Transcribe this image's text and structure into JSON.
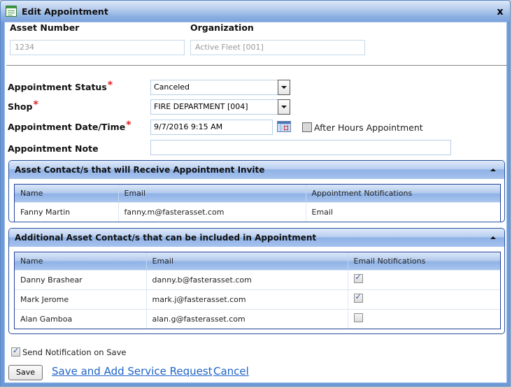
{
  "window": {
    "title": "Edit Appointment",
    "close_glyph": "x"
  },
  "header_fields": {
    "asset_number": {
      "label": "Asset Number",
      "value": "1234"
    },
    "organization": {
      "label": "Organization",
      "value": "Active Fleet [001]"
    }
  },
  "form": {
    "appointment_status": {
      "label": "Appointment Status",
      "required_mark": "*",
      "value": "Canceled"
    },
    "shop": {
      "label": "Shop",
      "required_mark": "*",
      "value": "FIRE DEPARTMENT [004]"
    },
    "appointment_datetime": {
      "label": "Appointment Date/Time",
      "required_mark": "*",
      "value": "9/7/2016 9:15 AM"
    },
    "after_hours": {
      "label": "After Hours Appointment",
      "checked": false
    },
    "appointment_note": {
      "label": "Appointment Note",
      "value": ""
    }
  },
  "invite_panel": {
    "title": "Asset Contact/s that will Receive Appointment Invite",
    "columns": [
      "Name",
      "Email",
      "Appointment Notifications"
    ],
    "rows": [
      {
        "name": "Fanny Martin",
        "email": "fanny.m@fasterasset.com",
        "notification": "Email"
      }
    ]
  },
  "additional_panel": {
    "title": "Additional Asset Contact/s that can be included in Appointment",
    "columns": [
      "Name",
      "Email",
      "Email Notifications"
    ],
    "rows": [
      {
        "name": "Danny Brashear",
        "email": "danny.b@fasterasset.com",
        "email_notification": true
      },
      {
        "name": "Mark Jerome",
        "email": "mark.j@fasterasset.com",
        "email_notification": true
      },
      {
        "name": "Alan Gamboa",
        "email": "alan.g@fasterasset.com",
        "email_notification": false
      }
    ]
  },
  "footer": {
    "send_notification": {
      "label": "Send Notification on Save",
      "checked": true
    },
    "save_label": "Save",
    "save_and_add_label": "Save and Add Service Request",
    "cancel_label": "Cancel"
  }
}
